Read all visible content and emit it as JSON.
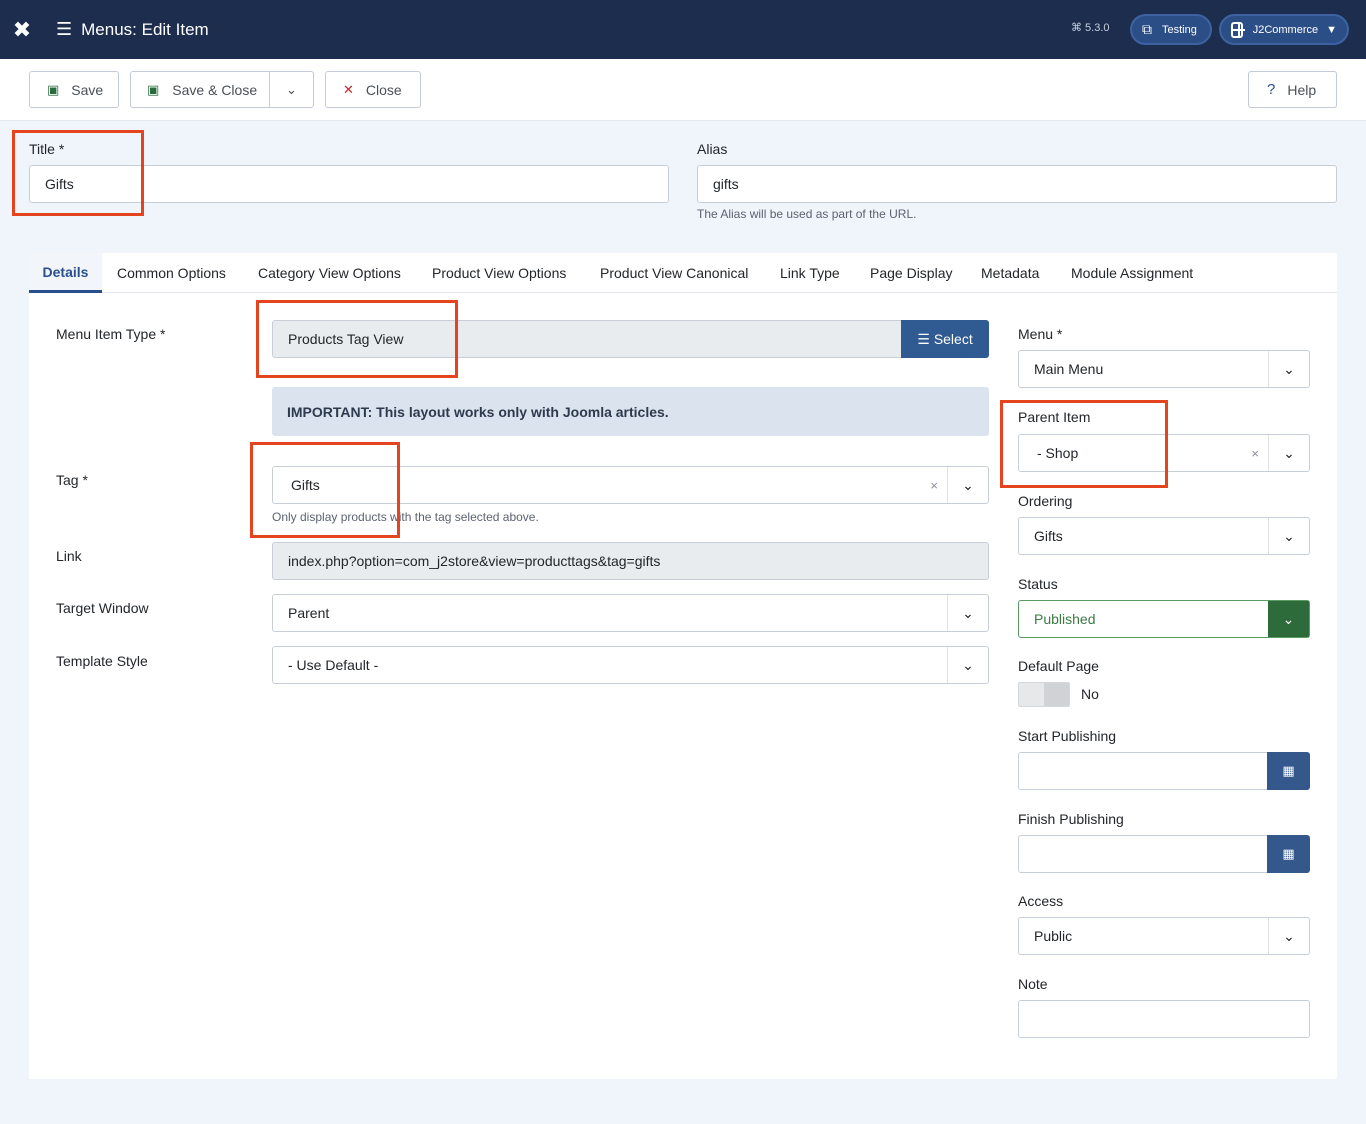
{
  "header": {
    "title": "Menus: Edit Item",
    "version": "⌘ 5.3.0",
    "site_button": "Testing",
    "user_button": "J2Commerce"
  },
  "toolbar": {
    "save": "Save",
    "save_close": "Save & Close",
    "close": "Close",
    "help": "Help"
  },
  "form": {
    "title_label": "Title *",
    "title_value": "Gifts",
    "alias_label": "Alias",
    "alias_value": "gifts",
    "alias_hint": "The Alias will be used as part of the URL."
  },
  "tabs": [
    "Details",
    "Common Options",
    "Category View Options",
    "Product View Options",
    "Product View Canonical",
    "Link Type",
    "Page Display",
    "Metadata",
    "Module Assignment"
  ],
  "details": {
    "menu_item_type_label": "Menu Item Type *",
    "menu_item_type_value": "Products Tag View",
    "select_button": "Select",
    "notice": "IMPORTANT: This layout works only with Joomla articles.",
    "tag_label": "Tag *",
    "tag_value": "Gifts",
    "tag_hint": "Only display products with the tag selected above.",
    "link_label": "Link",
    "link_value": "index.php?option=com_j2store&view=producttags&tag=gifts",
    "target_label": "Target Window",
    "target_value": "Parent",
    "template_label": "Template Style",
    "template_value": "- Use Default -"
  },
  "sidebar": {
    "menu_label": "Menu *",
    "menu_value": "Main Menu",
    "parent_label": "Parent Item",
    "parent_value": "- Shop",
    "ordering_label": "Ordering",
    "ordering_value": "Gifts",
    "status_label": "Status",
    "status_value": "Published",
    "default_label": "Default Page",
    "default_value": "No",
    "start_label": "Start Publishing",
    "start_value": "",
    "finish_label": "Finish Publishing",
    "finish_value": "",
    "access_label": "Access",
    "access_value": "Public",
    "note_label": "Note",
    "note_value": ""
  },
  "colors": {
    "header_bg": "#1c2d4e",
    "accent": "#2a4f8f",
    "highlight": "#e4451f",
    "published": "#2e6b3a"
  }
}
